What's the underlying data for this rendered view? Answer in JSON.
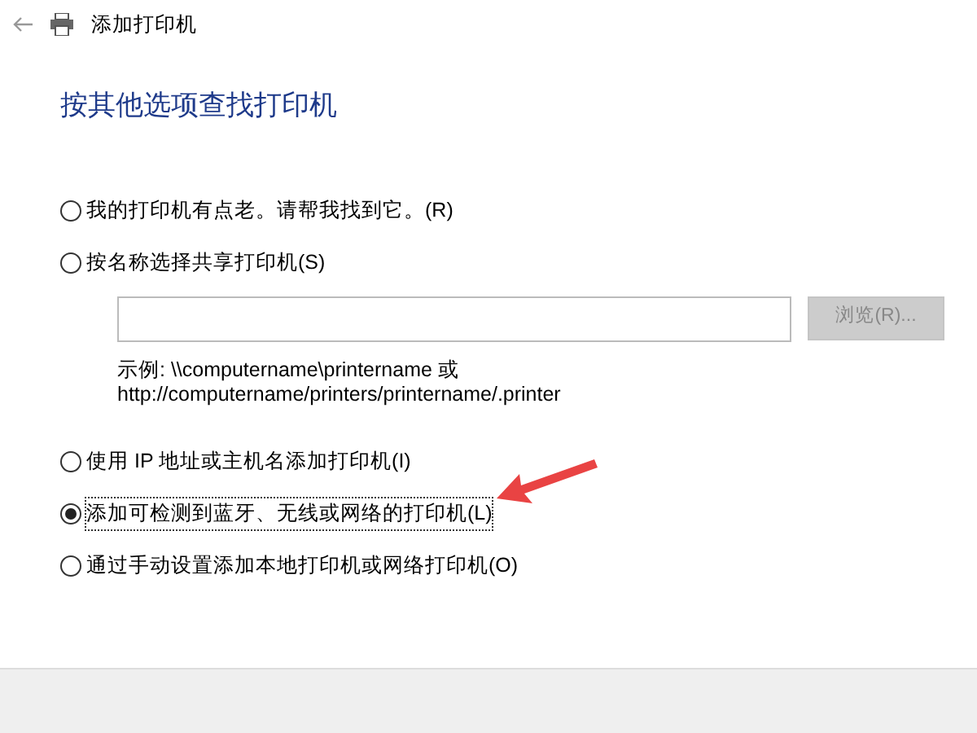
{
  "window": {
    "title": "添加打印机"
  },
  "heading": "按其他选项查找打印机",
  "options": [
    {
      "label": "我的打印机有点老。请帮我找到它。(R)",
      "selected": false
    },
    {
      "label": "按名称选择共享打印机(S)",
      "selected": false,
      "name_field": true,
      "browse": {
        "label": "浏览(R)...",
        "disabled": true
      },
      "hint_lines": [
        "示例: \\\\computername\\printername 或",
        "http://computername/printers/printername/.printer"
      ]
    },
    {
      "label": "使用 IP 地址或主机名添加打印机(I)",
      "selected": false
    },
    {
      "label": "添加可检测到蓝牙、无线或网络的打印机(L)",
      "selected": true
    },
    {
      "label": "通过手动设置添加本地打印机或网络打印机(O)",
      "selected": false
    }
  ]
}
